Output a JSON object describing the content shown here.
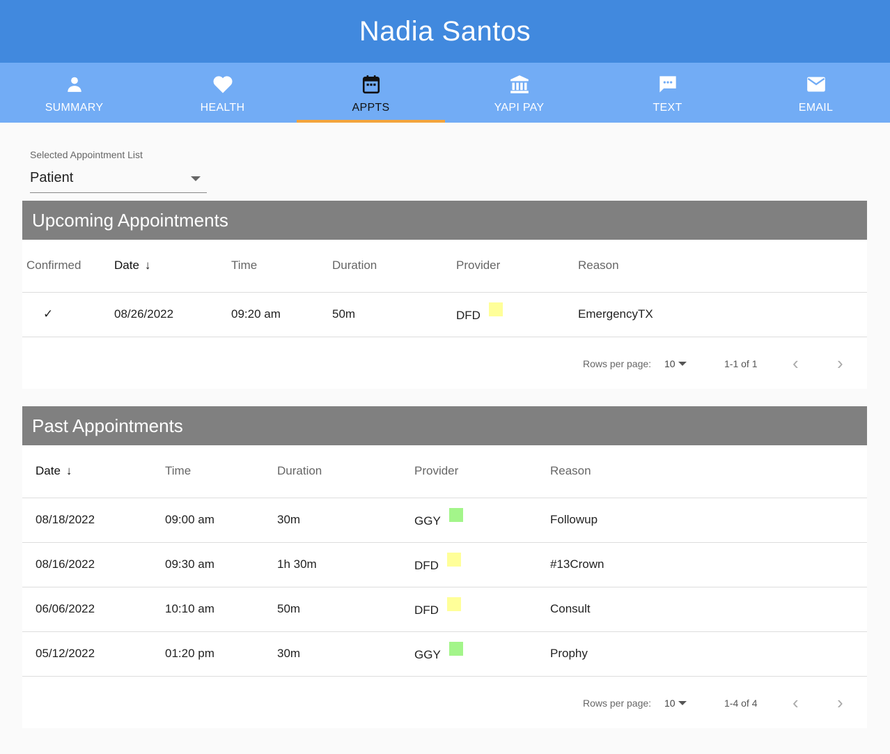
{
  "header": {
    "patient_name": "Nadia Santos"
  },
  "tabs": [
    {
      "label": "SUMMARY",
      "icon": "person-icon"
    },
    {
      "label": "HEALTH",
      "icon": "heart-icon"
    },
    {
      "label": "APPTS",
      "icon": "calendar-icon",
      "active": true
    },
    {
      "label": "YAPI PAY",
      "icon": "bank-icon"
    },
    {
      "label": "TEXT",
      "icon": "chat-icon"
    },
    {
      "label": "EMAIL",
      "icon": "mail-icon"
    }
  ],
  "colors": {
    "topbar": "#4189de",
    "tabbar": "#72acf5",
    "active_indicator": "#f3a43c",
    "section_header": "#808080",
    "provider_dfd": "#ffff99",
    "provider_ggy": "#a3f58a"
  },
  "list_select": {
    "caption": "Selected Appointment List",
    "value": "Patient"
  },
  "upcoming": {
    "title": "Upcoming Appointments",
    "columns": [
      "Confirmed",
      "Date",
      "Time",
      "Duration",
      "Provider",
      "Reason"
    ],
    "rows": [
      {
        "confirmed": "✓",
        "date": "08/26/2022",
        "time": "09:20 am",
        "duration": "50m",
        "provider": "DFD",
        "provider_color": "#ffff99",
        "reason": "EmergencyTX"
      }
    ],
    "footer": {
      "rows_per_page_label": "Rows per page:",
      "rows_per_page": "10",
      "range": "1-1 of 1"
    }
  },
  "past": {
    "title": "Past Appointments",
    "columns": [
      "Date",
      "Time",
      "Duration",
      "Provider",
      "Reason"
    ],
    "rows": [
      {
        "date": "08/18/2022",
        "time": "09:00 am",
        "duration": "30m",
        "provider": "GGY",
        "provider_color": "#a3f58a",
        "reason": "Followup"
      },
      {
        "date": "08/16/2022",
        "time": "09:30 am",
        "duration": "1h 30m",
        "provider": "DFD",
        "provider_color": "#ffff99",
        "reason": "#13Crown"
      },
      {
        "date": "06/06/2022",
        "time": "10:10 am",
        "duration": "50m",
        "provider": "DFD",
        "provider_color": "#ffff99",
        "reason": "Consult"
      },
      {
        "date": "05/12/2022",
        "time": "01:20 pm",
        "duration": "30m",
        "provider": "GGY",
        "provider_color": "#a3f58a",
        "reason": "Prophy"
      }
    ],
    "footer": {
      "rows_per_page_label": "Rows per page:",
      "rows_per_page": "10",
      "range": "1-4 of 4"
    }
  }
}
